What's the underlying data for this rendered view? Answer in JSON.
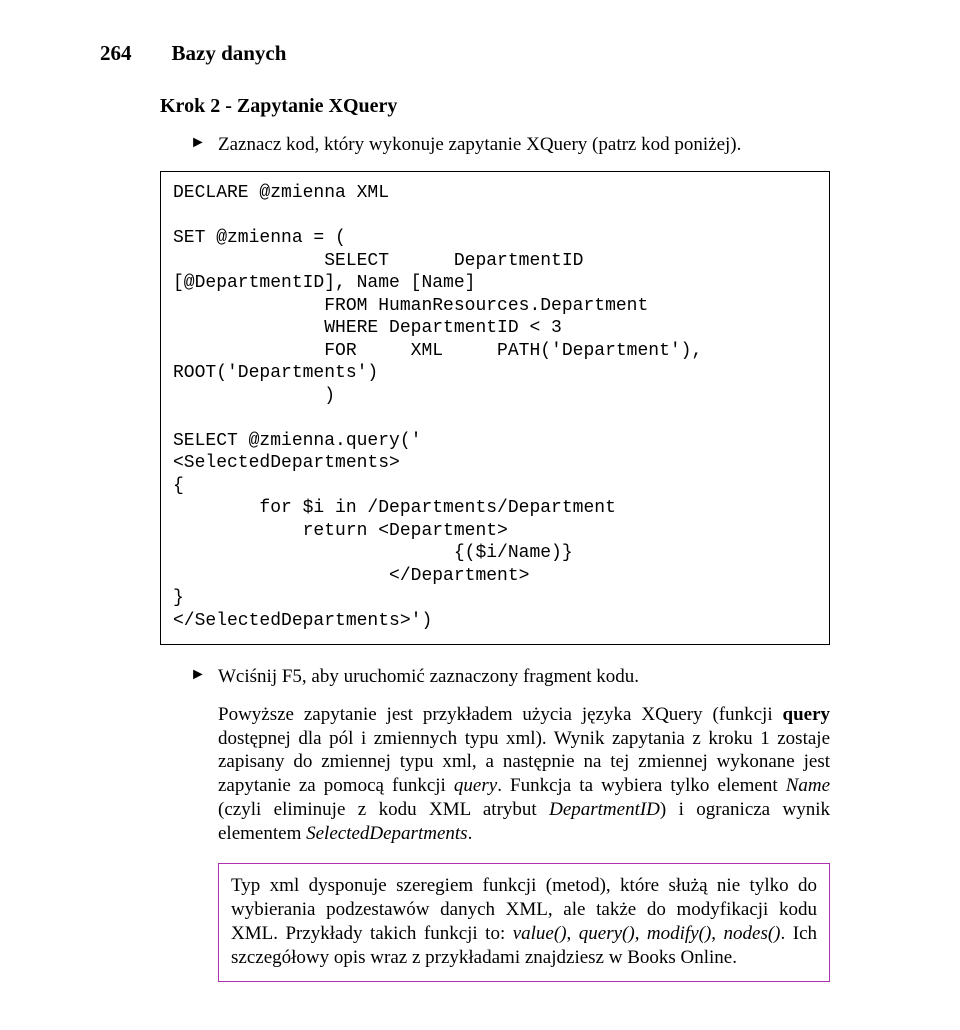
{
  "header": {
    "page_number": "264",
    "book_section": "Bazy danych"
  },
  "step": {
    "title": "Krok 2 - Zapytanie XQuery"
  },
  "bullets_top": [
    "Zaznacz kod, który wykonuje zapytanie XQuery (patrz kod poniżej)."
  ],
  "code": "DECLARE @zmienna XML\n\nSET @zmienna = (\n              SELECT      DepartmentID\n[@DepartmentID], Name [Name]\n              FROM HumanResources.Department\n              WHERE DepartmentID < 3\n              FOR     XML     PATH('Department'),\nROOT('Departments')\n              )\n\nSELECT @zmienna.query('\n<SelectedDepartments>\n{\n        for $i in /Departments/Department\n            return <Department>\n                          {($i/Name)}\n                    </Department>\n}\n</SelectedDepartments>')",
  "bullets_mid": [
    "Wciśnij F5, aby uruchomić zaznaczony fragment kodu."
  ],
  "para1": {
    "t1": "Powyższe zapytanie jest przykładem użycia języka XQuery (funkcji ",
    "b1": "query",
    "t2": " dostępnej dla pól i zmiennych typu xml). Wynik zapytania z kroku 1 zostaje zapisany do zmiennej typu xml, a następnie na tej zmiennej wykonane jest zapytanie za pomocą funkcji ",
    "i1": "query",
    "t3": ". Funkcja ta wybiera tylko element ",
    "i2": "Name",
    "t4": " (czyli eliminuje z kodu XML atrybut ",
    "i3": "DepartmentID",
    "t5": ") i ogranicza wynik elementem ",
    "i4": "SelectedDepartments",
    "t6": "."
  },
  "tip": {
    "t1": "Typ xml dysponuje szeregiem funkcji (metod), które służą nie tylko do wybierania podzestawów danych XML, ale także do modyfikacji kodu XML. Przykłady takich funkcji to: ",
    "i1": "value()",
    "t2": ", ",
    "i2": "query()",
    "t3": ", ",
    "i3": "modify()",
    "t4": ", ",
    "i4": "nodes()",
    "t5": ". Ich szczegółowy opis wraz z przykładami znajdziesz w Books Online."
  }
}
